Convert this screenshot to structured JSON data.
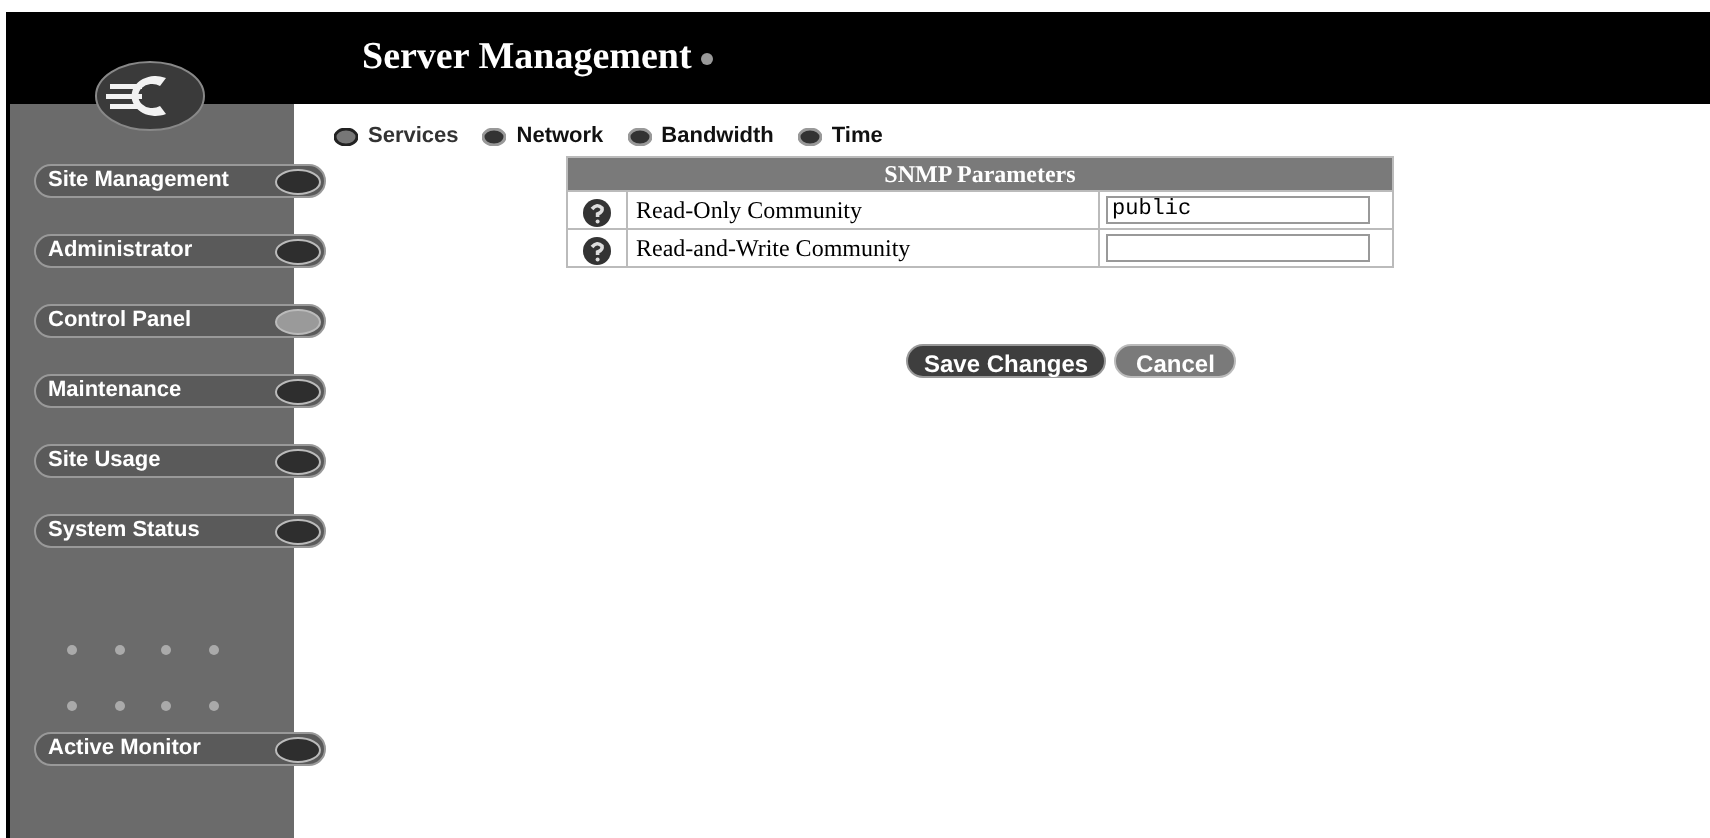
{
  "header": {
    "title": "Server Management"
  },
  "sidebar": {
    "items": [
      {
        "label": "Site Management",
        "selected": false
      },
      {
        "label": "Administrator",
        "selected": false
      },
      {
        "label": "Control Panel",
        "selected": true
      },
      {
        "label": "Maintenance",
        "selected": false
      },
      {
        "label": "Site Usage",
        "selected": false
      },
      {
        "label": "System Status",
        "selected": false
      }
    ],
    "bottom_items": [
      {
        "label": "Active Monitor",
        "selected": false
      }
    ]
  },
  "tabs": [
    {
      "label": "Services",
      "selected": true
    },
    {
      "label": "Network",
      "selected": false
    },
    {
      "label": "Bandwidth",
      "selected": false
    },
    {
      "label": "Time",
      "selected": false
    }
  ],
  "table": {
    "title": "SNMP Parameters",
    "rows": [
      {
        "label": "Read-Only Community",
        "value": "public"
      },
      {
        "label": "Read-and-Write Community"
      }
    ]
  },
  "buttons": [
    "Save Changes",
    "Cancel"
  ]
}
